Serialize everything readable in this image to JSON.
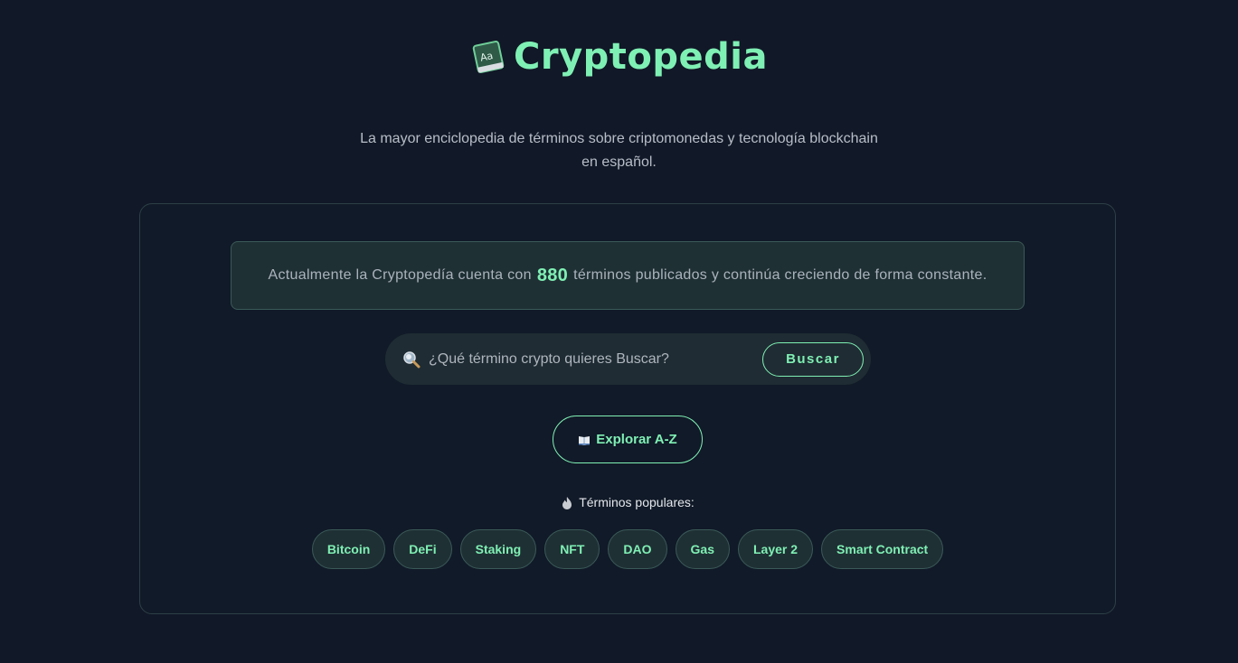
{
  "brand": {
    "name": "Cryptopedia",
    "logo_icon": "book-icon",
    "accent_color": "#7ff0b4"
  },
  "subtitle": {
    "line1": "La mayor enciclopedia de términos sobre criptomonedas y tecnología blockchain",
    "line2": "en español."
  },
  "stats": {
    "prefix": "Actualmente la Cryptopedía cuenta con",
    "count": "880",
    "suffix": "términos publicados y continúa creciendo de forma constante."
  },
  "search": {
    "icon": "search-icon",
    "placeholder": "¿Qué término crypto quieres Buscar?",
    "button_label": "Buscar"
  },
  "explore": {
    "icon": "book-icon",
    "label": "Explorar A-Z"
  },
  "popular": {
    "icon": "fire-icon",
    "label": "Términos populares:",
    "tags": [
      "Bitcoin",
      "DeFi",
      "Staking",
      "NFT",
      "DAO",
      "Gas",
      "Layer 2",
      "Smart Contract"
    ]
  }
}
